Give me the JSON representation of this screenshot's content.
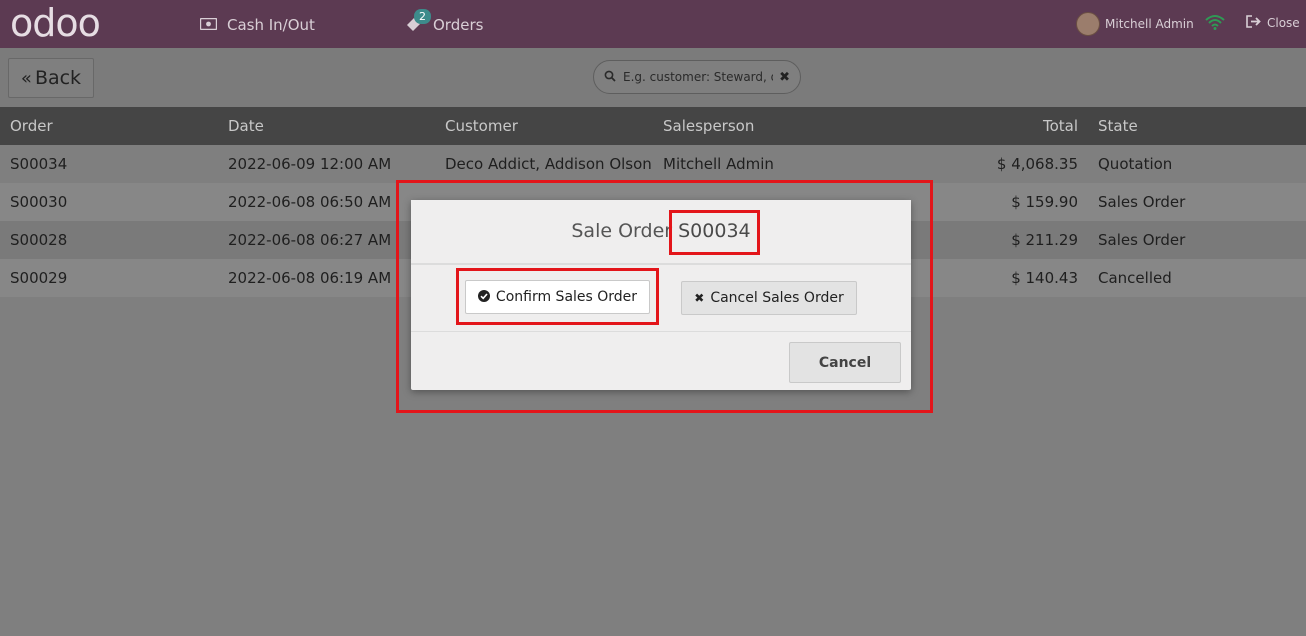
{
  "topbar": {
    "logo": "odoo",
    "nav": [
      {
        "label": "Cash In/Out",
        "icon": "cash-icon"
      },
      {
        "label": "Orders",
        "icon": "orders-icon",
        "badge": "2"
      }
    ],
    "user": {
      "name": "Mitchell Admin"
    },
    "close_label": "Close"
  },
  "controlbar": {
    "back_label": "Back",
    "search": {
      "placeholder": "E.g. customer: Steward, da"
    }
  },
  "table": {
    "columns": [
      "Order",
      "Date",
      "Customer",
      "Salesperson",
      "Total",
      "State"
    ],
    "rows": [
      {
        "order": "S00034",
        "date": "2022-06-09 12:00 AM",
        "customer": "Deco Addict, Addison Olson",
        "salesperson": "Mitchell Admin",
        "total": "$ 4,068.35",
        "state": "Quotation"
      },
      {
        "order": "S00030",
        "date": "2022-06-08 06:50 AM",
        "customer": "",
        "salesperson": "",
        "total": "$ 159.90",
        "state": "Sales Order"
      },
      {
        "order": "S00028",
        "date": "2022-06-08 06:27 AM",
        "customer": "",
        "salesperson": "",
        "total": "$ 211.29",
        "state": "Sales Order"
      },
      {
        "order": "S00029",
        "date": "2022-06-08 06:19 AM",
        "customer": "",
        "salesperson": "",
        "total": "$ 140.43",
        "state": "Cancelled"
      }
    ]
  },
  "modal": {
    "title_prefix": "Sale Order",
    "order_number": "S00034",
    "confirm_label": "Confirm Sales Order",
    "cancel_order_label": "Cancel Sales Order",
    "cancel_label": "Cancel"
  },
  "colors": {
    "topbar": "#5c3a52",
    "highlight": "#e3151a",
    "badge": "#3d8b8b"
  }
}
